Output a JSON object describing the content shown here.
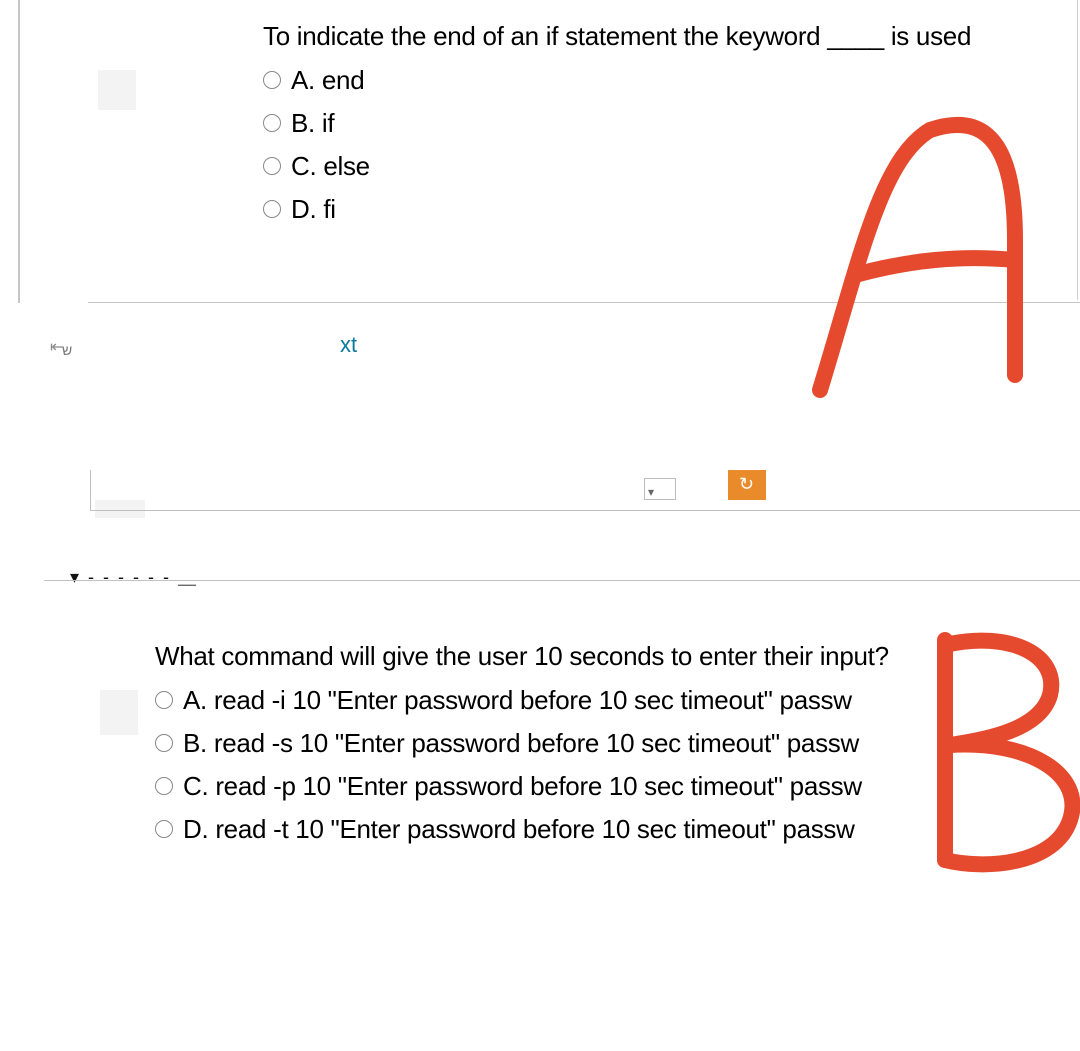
{
  "q1": {
    "prompt": "To indicate the end of an if statement the keyword ____ is used",
    "options": [
      {
        "label": "A. end"
      },
      {
        "label": "B. if"
      },
      {
        "label": "C. else"
      },
      {
        "label": "D. fi"
      }
    ]
  },
  "stray": {
    "xt": "xt",
    "orange_char": "↻",
    "dots": "▾ - - - - - -  ⸏"
  },
  "q2": {
    "prompt": "What command will give the user 10 seconds to enter their input?",
    "options": [
      {
        "label": "A. read -i 10 \"Enter password before 10 sec timeout\" passw"
      },
      {
        "label": "B. read -s 10 \"Enter password before 10 sec timeout\" passw"
      },
      {
        "label": "C. read -p 10 \"Enter password before 10 sec timeout\" passw"
      },
      {
        "label": "D. read -t 10 \"Enter password before 10 sec timeout\" passw"
      }
    ]
  },
  "annotations": {
    "hand_A": "A",
    "hand_B": "B"
  }
}
